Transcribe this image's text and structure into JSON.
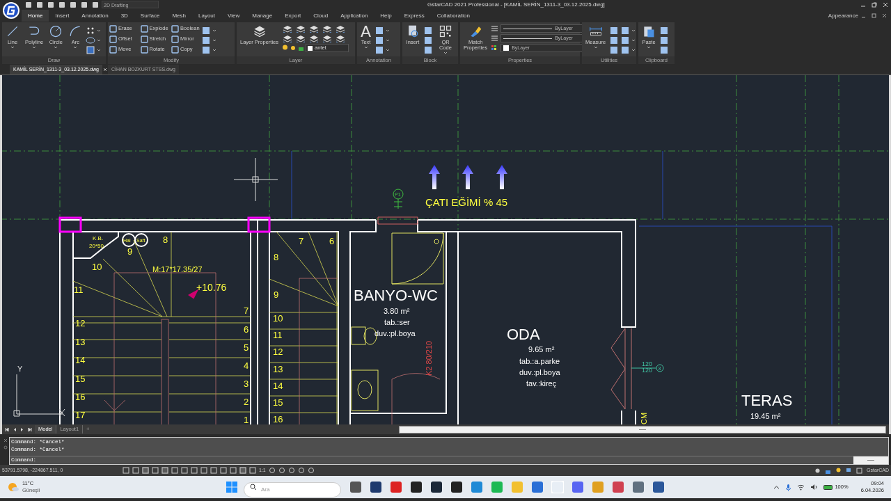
{
  "title_bar": {
    "workspace": "2D Drafting",
    "title": "GstarCAD 2021 Professional - [KAMİL SERİN_1311-3_03.12.2025.dwg]"
  },
  "ribbon_tabs": [
    {
      "label": "Home",
      "selected": true
    },
    {
      "label": "Insert",
      "selected": false
    },
    {
      "label": "Annotation",
      "selected": false
    },
    {
      "label": "3D",
      "selected": false
    },
    {
      "label": "Surface",
      "selected": false
    },
    {
      "label": "Mesh",
      "selected": false
    },
    {
      "label": "Layout",
      "selected": false
    },
    {
      "label": "View",
      "selected": false
    },
    {
      "label": "Manage",
      "selected": false
    },
    {
      "label": "Export",
      "selected": false
    },
    {
      "label": "Cloud",
      "selected": false
    },
    {
      "label": "Application",
      "selected": false
    },
    {
      "label": "Help",
      "selected": false
    },
    {
      "label": "Express",
      "selected": false
    },
    {
      "label": "Collaboration",
      "selected": false
    }
  ],
  "appearance": "Appearance",
  "panels": [
    {
      "title": "Draw",
      "tools": [
        {
          "kind": "large",
          "label": "Line"
        },
        {
          "kind": "large",
          "label": "Polyline"
        },
        {
          "kind": "large",
          "label": "Circle"
        },
        {
          "kind": "large",
          "label": "Arc"
        }
      ]
    },
    {
      "title": "Modify",
      "tools": [
        {
          "kind": "small",
          "label": "Erase"
        },
        {
          "kind": "small",
          "label": "Explode"
        },
        {
          "kind": "small",
          "label": "Boolean"
        },
        {
          "kind": "small",
          "label": "Offset"
        },
        {
          "kind": "small",
          "label": "Stretch"
        },
        {
          "kind": "small",
          "label": "Mirror"
        },
        {
          "kind": "small",
          "label": "Move"
        },
        {
          "kind": "small",
          "label": "Rotate"
        },
        {
          "kind": "small",
          "label": "Copy"
        }
      ]
    },
    {
      "title": "Layer",
      "tools": [
        {
          "kind": "large",
          "label": "Layer Properties"
        },
        {
          "kind": "field",
          "label": "antet"
        }
      ]
    },
    {
      "title": "Annotation",
      "tools": [
        {
          "kind": "large",
          "label": "Text",
          "glyph": "A"
        }
      ]
    },
    {
      "title": "Block",
      "tools": [
        {
          "kind": "large",
          "label": "Insert"
        },
        {
          "kind": "large",
          "label": "QR Code"
        }
      ]
    },
    {
      "title": "Properties",
      "tools": [
        {
          "kind": "large",
          "label": "Match Properties"
        },
        {
          "kind": "line",
          "label": "ByLayer"
        },
        {
          "kind": "line",
          "label": "ByLayer"
        },
        {
          "kind": "swatch",
          "label": "ByLayer"
        }
      ]
    },
    {
      "title": "Utilities",
      "tools": [
        {
          "kind": "large",
          "label": "Measure"
        }
      ]
    },
    {
      "title": "Clipboard",
      "tools": [
        {
          "kind": "large",
          "label": "Paste"
        }
      ]
    }
  ],
  "doc_tabs": [
    {
      "label": "KAMİL SERİN_1311-3_03.12.2025.dwg",
      "selected": true
    },
    {
      "label": "CİHAN BOZKURT STSS.dwg",
      "selected": false
    }
  ],
  "drawing": {
    "labels": [
      {
        "text": "K.B."
      },
      {
        "text": "20*50"
      },
      {
        "text": "Hal"
      },
      {
        "text": "Saft"
      },
      {
        "text": "8"
      },
      {
        "text": "9"
      },
      {
        "text": "10"
      },
      {
        "text": "11"
      },
      {
        "text": "M:17*17.35/27"
      },
      {
        "text": "+10.76"
      },
      {
        "text": "12"
      },
      {
        "text": "13"
      },
      {
        "text": "14"
      },
      {
        "text": "15"
      },
      {
        "text": "16"
      },
      {
        "text": "17"
      },
      {
        "text": "7"
      },
      {
        "text": "6"
      },
      {
        "text": "5"
      },
      {
        "text": "4"
      },
      {
        "text": "3"
      },
      {
        "text": "2"
      },
      {
        "text": "1"
      },
      {
        "text": "7"
      },
      {
        "text": "6"
      },
      {
        "text": "8"
      },
      {
        "text": "9"
      },
      {
        "text": "10"
      },
      {
        "text": "11"
      },
      {
        "text": "12"
      },
      {
        "text": "13"
      },
      {
        "text": "14"
      },
      {
        "text": "15"
      },
      {
        "text": "16"
      },
      {
        "text": "ÇATI EĞİMİ % 45"
      },
      {
        "text": "P1"
      },
      {
        "text": "BANYO-WC"
      },
      {
        "text": "3.80 m²"
      },
      {
        "text": "tab.:ser"
      },
      {
        "text": "duv.:pl.boya"
      },
      {
        "text": "K2 80/210"
      },
      {
        "text": "ODA"
      },
      {
        "text": "9.65 m²"
      },
      {
        "text": "tab.:a.parke"
      },
      {
        "text": "duv.:pl.boya"
      },
      {
        "text": "tav.:kireç"
      },
      {
        "text": "120"
      },
      {
        "text": "120"
      },
      {
        "text": "3"
      },
      {
        "text": "CM"
      },
      {
        "text": "TERAS"
      },
      {
        "text": "19.45 m²"
      },
      {
        "text": "Y"
      }
    ]
  },
  "layout_tabs": [
    {
      "label": "Model",
      "selected": true
    },
    {
      "label": "Layout1",
      "selected": false
    }
  ],
  "new_layout": "+",
  "command_history": [
    "Command: *Cancel*",
    "Command: *Cancel*"
  ],
  "command_prompt": "Command:",
  "status_bar": {
    "coordinates": "53791.5798, -224867.511, 0",
    "scale": "1:1",
    "app_label": "GstarCAD"
  },
  "taskbar": {
    "temperature": "11°C",
    "weather": "Güneşli",
    "search_placeholder": "Ara",
    "battery": "100%",
    "time": "09:04",
    "date": "6.04.2026"
  }
}
